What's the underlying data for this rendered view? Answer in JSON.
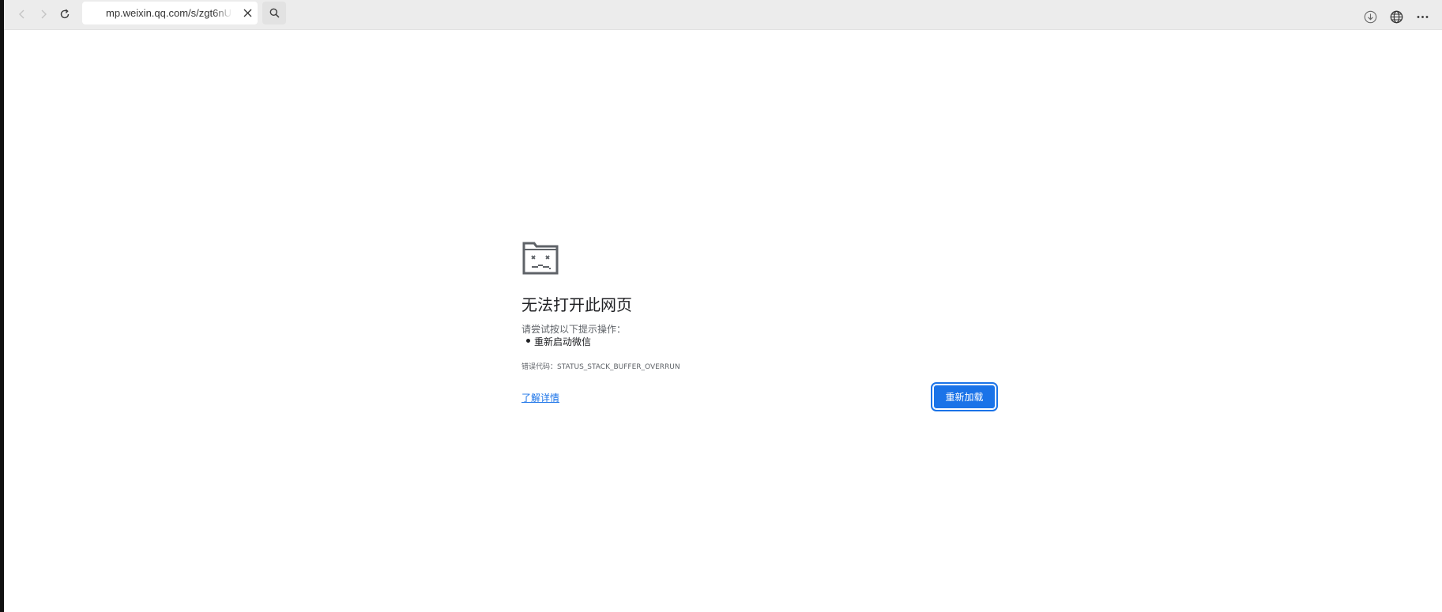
{
  "browser": {
    "url": "mp.weixin.qq.com/s/zgt6nU",
    "icons": {
      "back": "chevron-left-icon",
      "forward": "chevron-right-icon",
      "reload": "reload-icon",
      "close": "close-icon",
      "search": "search-icon",
      "download": "download-icon",
      "globe": "globe-icon",
      "more": "more-icon"
    }
  },
  "error": {
    "icon": "sad-folder-icon",
    "title": "无法打开此网页",
    "suggest_label": "请尝试按以下提示操作：",
    "suggestions": [
      "重新启动微信"
    ],
    "code_label": "错误代码：",
    "code": "STATUS_STACK_BUFFER_OVERRUN",
    "learn_more": "了解详情",
    "reload_label": "重新加载"
  },
  "colors": {
    "accent": "#1a73e8",
    "toolbar_bg": "#ececec",
    "text": "#202124",
    "secondary_text": "#5f6368"
  }
}
